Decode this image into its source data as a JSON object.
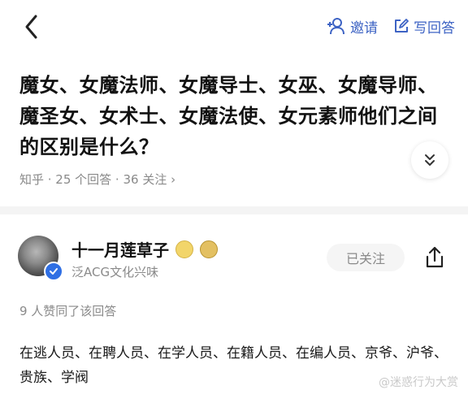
{
  "topbar": {
    "back_icon": "chevron-left-icon",
    "invite_label": "邀请",
    "write_answer_label": "写回答",
    "accent_color": "#3d63c4"
  },
  "question": {
    "title": "魔女、女魔法师、女魔导士、女巫、女魔导师、魔圣女、女术士、女魔法使、女元素师他们之间的区别是什么？",
    "meta": "知乎 · 25 个回答 · 36 关注 ›"
  },
  "answer": {
    "author_name": "十一月莲草子",
    "author_tagline": "泛ACG文化兴味",
    "follow_label": "已关注",
    "likes_text": "9 人赞同了该回答",
    "content": "在逃人员、在聘人员、在学人员、在籍人员、在编人员、京爷、沪爷、贵族、学阀"
  },
  "watermark": "@迷惑行为大赏"
}
